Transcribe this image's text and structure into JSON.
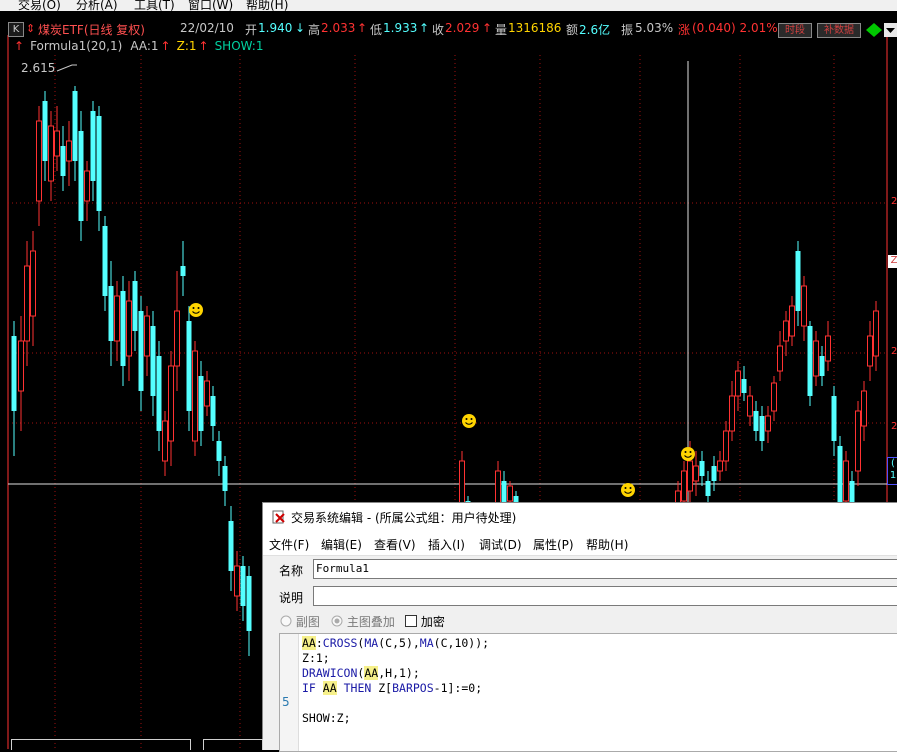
{
  "menu": [
    "交易(O)",
    "分析(A)",
    "工具(T)",
    "窗口(W)",
    "帮助(H)"
  ],
  "quote": {
    "k_badge": "K",
    "title": "煤炭ETF(日线  复权)",
    "date": "22/02/10",
    "open_label": "开",
    "open_value": "1.940",
    "open_arrow": "↓",
    "high_label": "高",
    "high_value": "2.033",
    "high_arrow": "↑",
    "low_label": "低",
    "low_value": "1.933",
    "low_arrow": "↑",
    "close_label": "收",
    "close_value": "2.029",
    "close_arrow": "↑",
    "volume_label": "量",
    "volume_value": "1316186",
    "amount_label": "额",
    "amount_value": "2.6亿",
    "amp_label": "振",
    "amp_value": "5.03%",
    "change_label": "涨",
    "change_value": "(0.040) 2.01%",
    "btn_period": "时段",
    "btn_supplement": "补数据"
  },
  "formula_line": {
    "name": "Formula1(20,1)",
    "aa": "AA:1",
    "z": "Z:1",
    "show": "SHOW:1"
  },
  "chart": {
    "high_label": "2.615",
    "right_labels": [
      "2",
      "2",
      "Z",
      "2",
      "2"
    ],
    "bottom_right": [
      "(",
      "1"
    ],
    "colors": {
      "up": "#ff3232",
      "down": "#54ffff",
      "icon": "#ffd400",
      "grid": "#a01010"
    }
  },
  "editor": {
    "title": "交易系统编辑 - (所属公式组：用户待处理)",
    "menu": [
      "文件(F)",
      "编辑(E)",
      "查看(V)",
      "插入(I)",
      "调试(D)",
      "属性(P)",
      "帮助(H)"
    ],
    "name_label": "名称",
    "name_value": "Formula1",
    "desc_label": "说明",
    "desc_value": "",
    "opt_sub": "副图",
    "opt_main": "主图叠加",
    "opt_encrypt": "加密",
    "gutter_number": "5",
    "code_lines": [
      "AA:CROSS(MA(C,5),MA(C,10));",
      "Z:1;",
      "DRAWICON(AA,H,1);",
      "IF AA THEN Z[BARPOS-1]:=0;",
      "",
      "SHOW:Z;"
    ]
  }
}
